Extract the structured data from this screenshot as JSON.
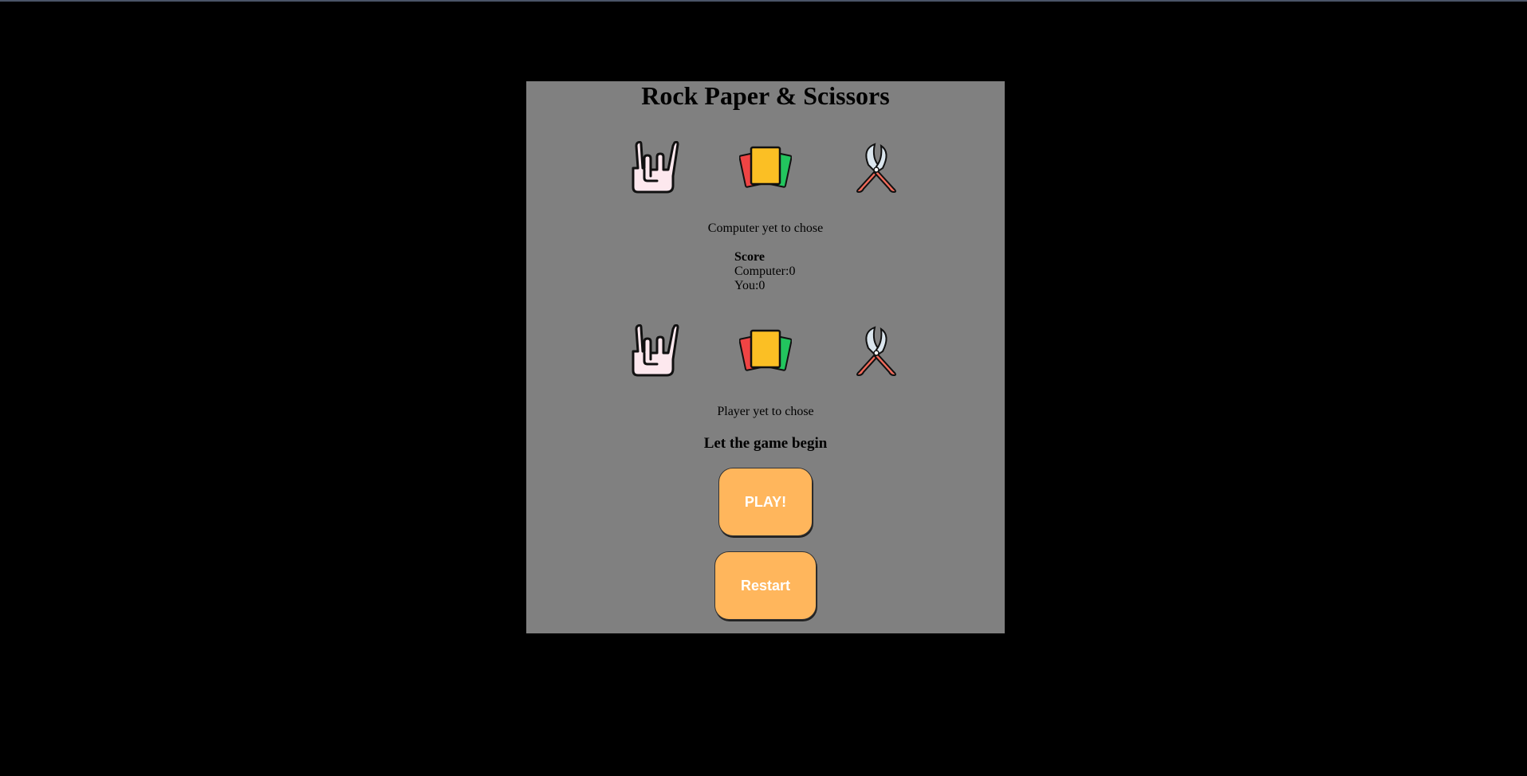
{
  "title": "Rock Paper & Scissors",
  "computer": {
    "choices": [
      {
        "icon": "rock-hand-icon"
      },
      {
        "icon": "paper-cards-icon"
      },
      {
        "icon": "scissors-icon"
      }
    ],
    "status": "Computer yet to chose"
  },
  "score": {
    "title": "Score",
    "computer_label": "Computer:",
    "computer_value": "0",
    "you_label": "You:",
    "you_value": "0"
  },
  "player": {
    "choices": [
      {
        "icon": "rock-hand-icon"
      },
      {
        "icon": "paper-cards-icon"
      },
      {
        "icon": "scissors-icon"
      }
    ],
    "status": "Player yet to chose"
  },
  "message": "Let the game begin",
  "buttons": {
    "play": "PLAY!",
    "restart": "Restart"
  },
  "colors": {
    "page_background": "#000000",
    "panel_background": "#808080",
    "button_background": "#FFB65C",
    "button_text": "#FFFFFF"
  }
}
